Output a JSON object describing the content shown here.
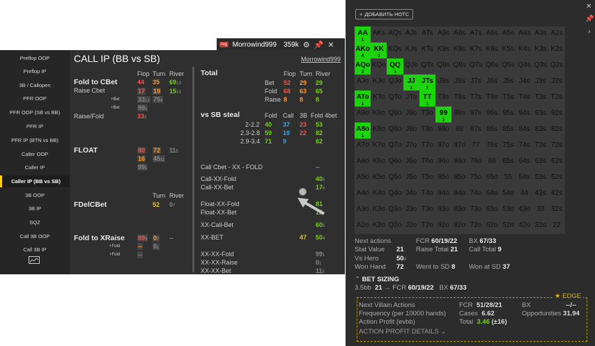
{
  "hud": {
    "badge": "reg",
    "player": "Morrowind999",
    "stack": "359k"
  },
  "sidebar": {
    "items": [
      "Preflop OOP",
      "Preflop IP",
      "3B / Callopen",
      "PFR OOP",
      "PFR OOP (SB vs BB)",
      "PFR IP",
      "PFR IP (BTN vs BB)",
      "Caller OOP",
      "Caller IP",
      "Caller IP (BB vs SB)",
      "3B OOP",
      "3B IP",
      "SQZ",
      "Call 3B OOP",
      "Call 3B IP"
    ],
    "active": "Caller IP (BB vs SB)"
  },
  "main": {
    "title": "CALL IP (BB vs SB)",
    "player_link": "Morrowind999",
    "col_headers": [
      "Flop",
      "Turn",
      "River"
    ],
    "fold_cbet": {
      "label": "Fold to CBet",
      "sub1": "Raise Cbet",
      "sub2": "+Bet",
      "sub3": "+Bet",
      "sub4": "Raise/Fold",
      "r1": [
        "44",
        "35",
        "69",
        "13"
      ],
      "r2": [
        "17",
        "19",
        "19",
        "15",
        "13"
      ],
      "r3": [
        "33",
        "12",
        "75",
        "4"
      ],
      "r4": [
        "99",
        "1"
      ],
      "r5": [
        "33",
        "3"
      ]
    },
    "float": {
      "label": "FLOAT",
      "r1": [
        "80",
        "72",
        "11",
        "5"
      ],
      "r2": [
        "16",
        "45",
        "11"
      ],
      "r3": [
        "99",
        "1"
      ]
    },
    "fdelcbet": {
      "label": "FDelCBet",
      "headers": [
        "Turn",
        "River"
      ],
      "r1": [
        "52",
        "0",
        "7"
      ]
    },
    "fold_xraise": {
      "label": "Fold to XRaise",
      "sub1": "+Fold",
      "sub2": "+Fold",
      "r1": [
        "89",
        "9",
        "0",
        "7",
        "--"
      ],
      "r2": [
        "--",
        "0",
        "1"
      ],
      "r3": [
        "--"
      ]
    }
  },
  "total": {
    "label": "Total",
    "headers": [
      "Flop",
      "Turn",
      "River"
    ],
    "rows": [
      {
        "label": "Bet",
        "v": [
          "52",
          "29",
          "29"
        ]
      },
      {
        "label": "Fold",
        "v": [
          "68",
          "63",
          "65"
        ]
      },
      {
        "label": "Raise",
        "v": [
          "8",
          "8",
          "8"
        ]
      }
    ],
    "steal": {
      "label": "vs SB steal",
      "headers": [
        "Fold",
        "Call",
        "3B",
        "Fold 4bet"
      ],
      "rows": [
        {
          "label": "2-2.2",
          "v": [
            "40",
            "37",
            "23",
            "53"
          ]
        },
        {
          "label": "2.3-2.8",
          "v": [
            "59",
            "19",
            "22",
            "82"
          ]
        },
        {
          "label": "2.9-3.4",
          "v": [
            "71",
            "9",
            "",
            "62"
          ]
        }
      ]
    },
    "lines": [
      {
        "label": "Call Cbet - XX - FOLD",
        "v": "--"
      },
      {
        "label": "Call-XX-Fold",
        "v": "40",
        "s": "5"
      },
      {
        "label": "Call-XX-Bet",
        "v": "17",
        "s": "6"
      },
      {
        "label": "Float-XX-Fold",
        "v": "81"
      },
      {
        "label": "Float-XX-Bet",
        "v": "15"
      },
      {
        "label": "XX-Call-Bet",
        "v": "60",
        "s": "5"
      },
      {
        "label": "XX-BET",
        "v": "47",
        "v2": "50",
        "s": "4"
      },
      {
        "label": "XX-XX-Fold",
        "v": "99",
        "s": "1"
      },
      {
        "label": "XX-XX-Raise",
        "v": "0",
        "s": "1"
      },
      {
        "label": "XX-XX-Bet",
        "v": "11",
        "s": "5"
      }
    ]
  },
  "right": {
    "note_button": "ДОБАВИТЬ НОТС",
    "grid_on": {
      "AA": "1",
      "AKo": "4",
      "KK": "1",
      "AQo": "2",
      "QQ": "1",
      "JJ": "1",
      "JTs": "1",
      "ATo": "1",
      "TT": "1",
      "99": "1",
      "A8o": "1"
    },
    "stats": {
      "next_actions": "Next actions",
      "fcr_l": "FCR",
      "fcr_v": "60/19/22",
      "bx_l": "BX",
      "bx_v": "67/33",
      "stat_value_l": "Stat Value",
      "stat_value_v": "21",
      "raise_total_l": "Raise Total",
      "raise_total_v": "21",
      "call_total_l": "Call Total",
      "call_total_v": "9",
      "vs_hero_l": "Vs Hero",
      "vs_hero_v": "50",
      "vs_hero_s": "4",
      "won_hand_l": "Won Hand",
      "won_hand_v": "72",
      "went_sd_l": "Went to SD",
      "went_sd_v": "8",
      "won_sd_l": "Won at SD",
      "won_sd_v": "37"
    },
    "bet_sizing": {
      "title": "BET SIZING",
      "size": "3.5bb",
      "v": "21",
      "arrow": "→",
      "fcr_l": "FCR",
      "fcr_v": "60/19/22",
      "bx_l": "BX",
      "bx_v": "67/33"
    },
    "edge": {
      "badge": "EDGE",
      "nva": "Next Villain Actions",
      "fcr_l": "FCR",
      "fcr_v": "51/28/21",
      "bx_l": "BX",
      "bx_v": "--/--",
      "freq": "Frequency (per 10000 hands)",
      "cases_l": "Cases",
      "cases_v": "6.62",
      "opp_l": "Opportunities",
      "opp_v": "31.94",
      "ap": "Action Profit (evbb)",
      "total_l": "Total",
      "total_v": "3.46",
      "total_pm": "(±16)",
      "details": "ACTION PROFIT DETAILS"
    },
    "colors": {
      "green_cell": "#1bd40c",
      "red": "#f0564e",
      "orange": "#ff9a2e",
      "green": "#73d216",
      "blue": "#39a6e8"
    }
  }
}
